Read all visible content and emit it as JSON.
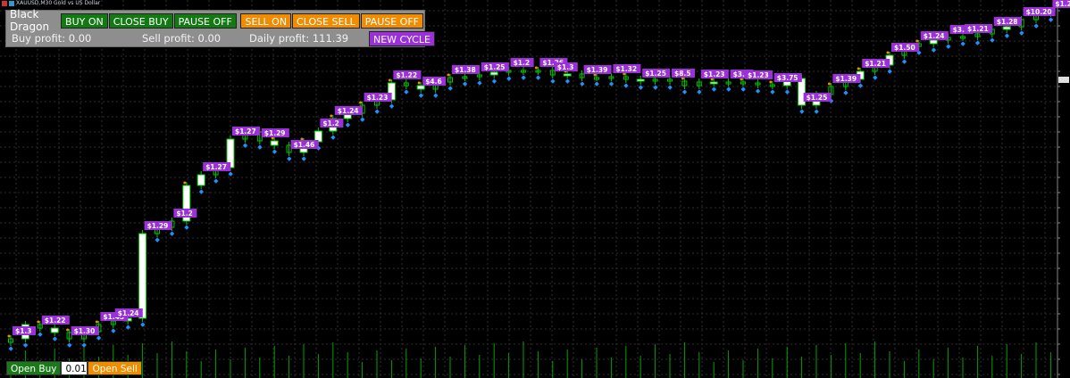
{
  "window": {
    "title": "XAUUSD,M30 Gold vs US Dollar"
  },
  "panel": {
    "title": "Black Dragon",
    "buy_on": "BUY ON",
    "close_buy": "CLOSE BUY",
    "pause_off_buy": "PAUSE OFF",
    "sell_on": "SELL ON",
    "close_sell": "CLOSE SELL",
    "pause_off_sell": "PAUSE OFF",
    "buy_profit": "Buy profit: 0.00",
    "sell_profit": "Sell profit: 0.00",
    "daily_profit": "Daily profit: 111.39",
    "new_cycle": "NEW CYCLE"
  },
  "bottom": {
    "open_buy": "Open Buy",
    "lot": "0.01",
    "open_sell": "Open Sell"
  },
  "colors": {
    "background": "#000000",
    "grid": "#2e2e2e",
    "bull_candle": "#00c800",
    "body_fill": "#ffffff",
    "profit_tag": "#9b30d9",
    "buy_arrow": "#1e90ff",
    "sell_marker": "#f08c00",
    "volume": "#00a000"
  },
  "chart_data": {
    "type": "candlestick",
    "instrument": "XAUUSD",
    "timeframe": "M30",
    "closes": [
      380,
      364,
      368,
      373,
      380,
      372,
      364,
      360,
      357,
      262,
      255,
      248,
      208,
      196,
      188,
      156,
      148,
      158,
      163,
      171,
      159,
      147,
      133,
      127,
      118,
      112,
      93,
      96,
      100,
      92,
      87,
      86,
      84,
      81,
      79,
      80,
      79,
      84,
      83,
      87,
      87,
      86,
      89,
      91,
      89,
      91,
      96,
      92,
      93,
      92,
      93,
      95,
      96,
      88,
      118,
      106,
      97,
      89,
      80,
      73,
      62,
      52,
      49,
      45,
      42,
      41,
      38,
      33,
      30,
      22,
      15,
      13
    ],
    "profit_labels": [
      "$1.3",
      "$1.22",
      "$1.30",
      "$1.45",
      "$1.24",
      "$1.29",
      "$1.2",
      "$1.27",
      "$1.27",
      "$1.29",
      "$1.46",
      "$1.2",
      "$1.24",
      "$1.23",
      "$1.22",
      "$4.6",
      "$1.38",
      "$1.25",
      "$1.2",
      "$1.26",
      "$1.3",
      "$1.39",
      "$1.32",
      "$1.25",
      "$8.5",
      "$1.23",
      "$3.8",
      "$1.23",
      "$3.75",
      "$1.25",
      "$1.39",
      "$1.21",
      "$1.50",
      "$1.24",
      "$3.9",
      "$1.21",
      "$1.28",
      "$10.20",
      "$1.2"
    ]
  }
}
